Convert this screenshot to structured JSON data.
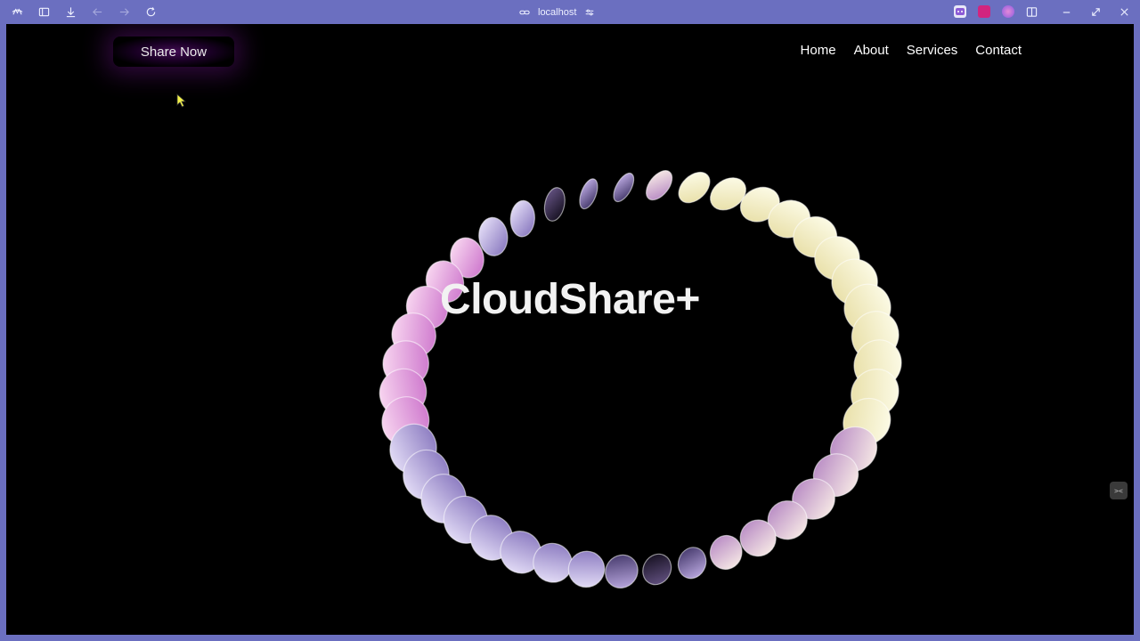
{
  "browser": {
    "url": "localhost"
  },
  "header": {
    "share_button": "Share Now",
    "nav": [
      "Home",
      "About",
      "Services",
      "Contact"
    ]
  },
  "hero": {
    "title": "CloudShare+"
  },
  "side_toggle": "><",
  "colors": {
    "chrome": "#6b6fc0",
    "background": "#000000",
    "glow": "#6e148c",
    "accent_pink": "#e7a6df",
    "accent_yellow": "#f6f3c4"
  }
}
